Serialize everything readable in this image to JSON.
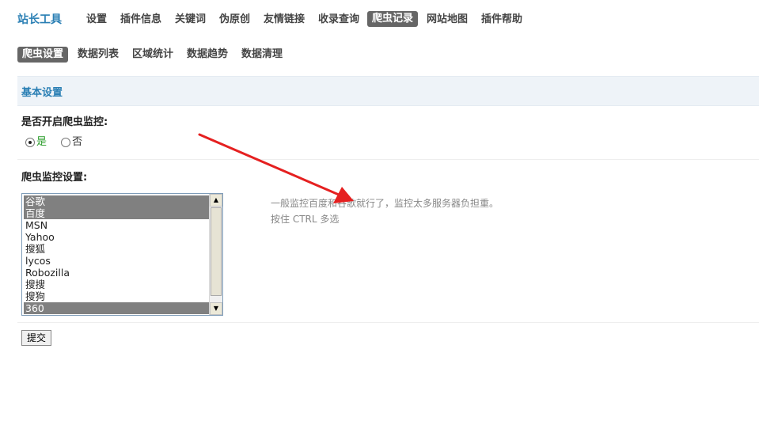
{
  "brand": "站长工具",
  "nav": [
    "设置",
    "插件信息",
    "关键词",
    "伪原创",
    "友情链接",
    "收录查询",
    "爬虫记录",
    "网站地图",
    "插件帮助"
  ],
  "nav_active": "爬虫记录",
  "subnav": [
    "爬虫设置",
    "数据列表",
    "区域统计",
    "数据趋势",
    "数据清理"
  ],
  "subnav_active": "爬虫设置",
  "panel_title": "基本设置",
  "monitor_label": "是否开启爬虫监控:",
  "radio_yes": "是",
  "radio_no": "否",
  "radio_selected": "是",
  "settings_label": "爬虫监控设置:",
  "crawler_options": [
    {
      "label": "谷歌",
      "selected": true
    },
    {
      "label": "百度",
      "selected": true
    },
    {
      "label": "MSN",
      "selected": false
    },
    {
      "label": "Yahoo",
      "selected": false
    },
    {
      "label": "搜狐",
      "selected": false
    },
    {
      "label": "lycos",
      "selected": false
    },
    {
      "label": "Robozilla",
      "selected": false
    },
    {
      "label": "搜搜",
      "selected": false
    },
    {
      "label": "搜狗",
      "selected": false
    },
    {
      "label": "360",
      "selected": true
    }
  ],
  "hint_line1": "一般监控百度和谷歌就行了，监控太多服务器负担重。",
  "hint_line2": "按住 CTRL 多选",
  "submit_label": "提交",
  "colors": {
    "brand": "#2a7fb4",
    "active_bg": "#666666",
    "arrow": "#e52020",
    "selected_option": "#808080"
  }
}
